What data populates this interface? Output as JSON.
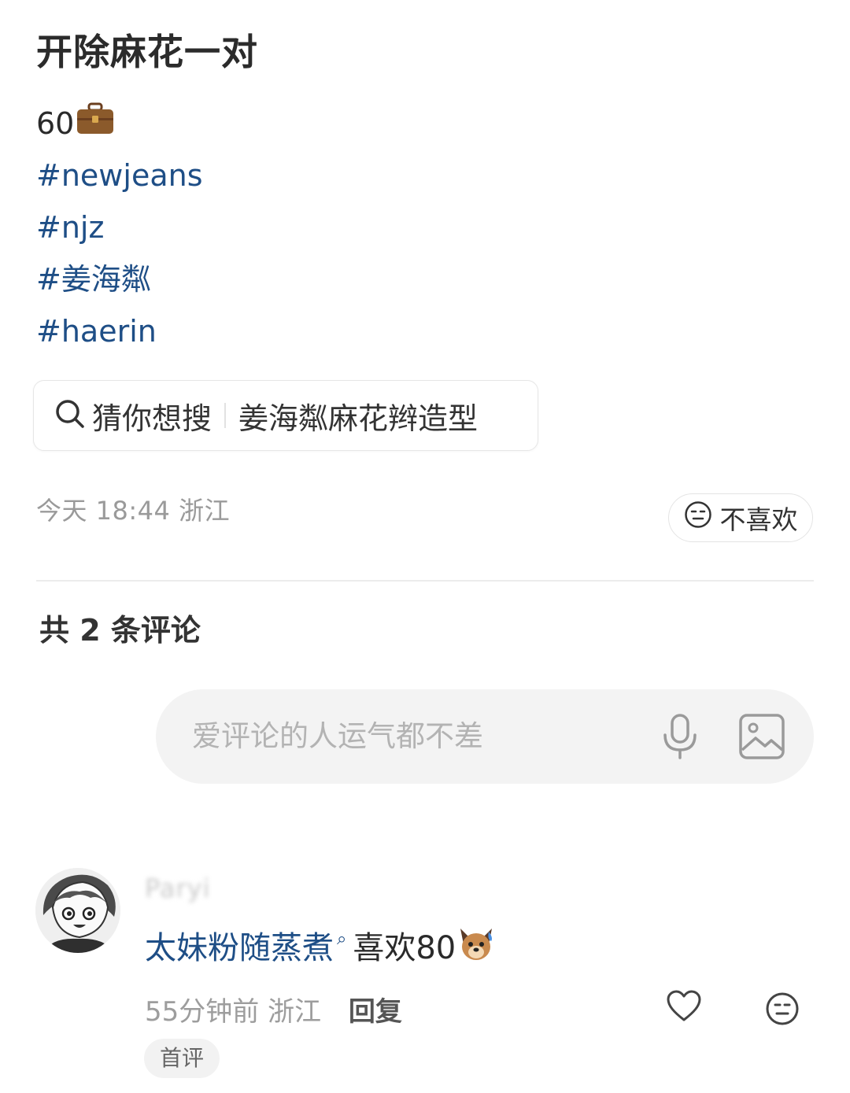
{
  "post": {
    "title": "开除麻花一对",
    "price_text": "60",
    "price_emoji": "briefcase",
    "hashtags": [
      "#newjeans",
      "#njz",
      "#姜海粼",
      "#haerin"
    ]
  },
  "search_suggestion": {
    "prefix": "猜你想搜",
    "query": "姜海粼麻花辫造型"
  },
  "meta": {
    "time_location": "今天 18:44 浙江",
    "dislike_label": "不喜欢"
  },
  "comments": {
    "header": "共 2 条评论",
    "input_placeholder": "爱评论的人运气都不差",
    "items": [
      {
        "username": "Paryi",
        "mention": "太妹粉随蒸煮",
        "text": "喜欢80",
        "emoji": "dog-sweat",
        "time_location": "55分钟前 浙江",
        "reply_label": "回复",
        "badge": "首评"
      }
    ]
  },
  "colors": {
    "hashtag": "#1e4e86",
    "meta_gray": "#9a9a9a",
    "input_bg": "#f3f3f3"
  }
}
